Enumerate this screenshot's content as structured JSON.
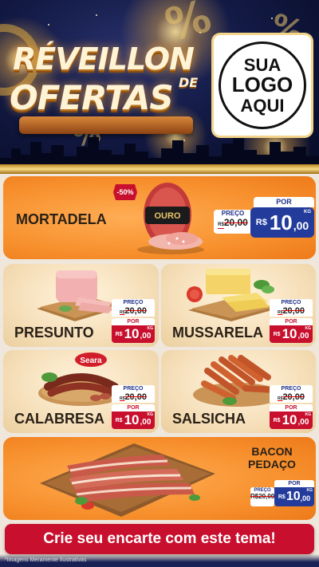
{
  "header": {
    "title_line1": "RÉVEILLON",
    "title_de": "DE",
    "title_line2": "OFERTAS",
    "logo": {
      "line1": "SUA",
      "line2": "LOGO",
      "line3": "AQUI"
    }
  },
  "products": {
    "mortadela": {
      "name": "MORTADELA",
      "badge": "-50%",
      "brand": "OURO",
      "price_label": "PREÇO",
      "old_currency": "R$",
      "old_price": "20,00",
      "por_label": "POR",
      "currency": "R$",
      "price_int": "10",
      "price_dec": ",00",
      "unit": "KG"
    },
    "presunto": {
      "name": "PRESUNTO",
      "price_label": "PREÇO",
      "old_currency": "R$",
      "old_price": "20,00",
      "por_label": "POR",
      "currency": "R$",
      "price_int": "10",
      "price_dec": ",00",
      "unit": "KG"
    },
    "mussarela": {
      "name": "MUSSARELA",
      "price_label": "PREÇO",
      "old_currency": "R$",
      "old_price": "20,00",
      "por_label": "POR",
      "currency": "R$",
      "price_int": "10",
      "price_dec": ",00",
      "unit": "KG"
    },
    "calabresa": {
      "name": "CALABRESA",
      "brand": "Seara",
      "price_label": "PREÇO",
      "old_currency": "R$",
      "old_price": "20,00",
      "por_label": "POR",
      "currency": "R$",
      "price_int": "10",
      "price_dec": ",00",
      "unit": "KG"
    },
    "salsicha": {
      "name": "SALSICHA",
      "price_label": "PREÇO",
      "old_currency": "R$",
      "old_price": "20,00",
      "por_label": "POR",
      "currency": "R$",
      "price_int": "10",
      "price_dec": ",00",
      "unit": "KG"
    },
    "bacon": {
      "name_line1": "BACON",
      "name_line2": "PEDAÇO",
      "price_label": "PREÇO",
      "old_currency": "R$",
      "old_price": "20,00",
      "por_label": "POR",
      "currency": "R$",
      "price_int": "10",
      "price_dec": ",00",
      "unit": "KG"
    }
  },
  "cta": {
    "label": "Crie seu encarte com este tema!"
  },
  "footer": {
    "note": "*Imagens Meramente Ilustrativas"
  },
  "colors": {
    "orange_card": "#f7902d",
    "beige_card": "#f6dfba",
    "red": "#c8102e",
    "blue": "#233c9c",
    "gold": "#e9c46a"
  },
  "icons": [
    "percent-decoration-icon",
    "firework-icon",
    "city-skyline-icon"
  ]
}
